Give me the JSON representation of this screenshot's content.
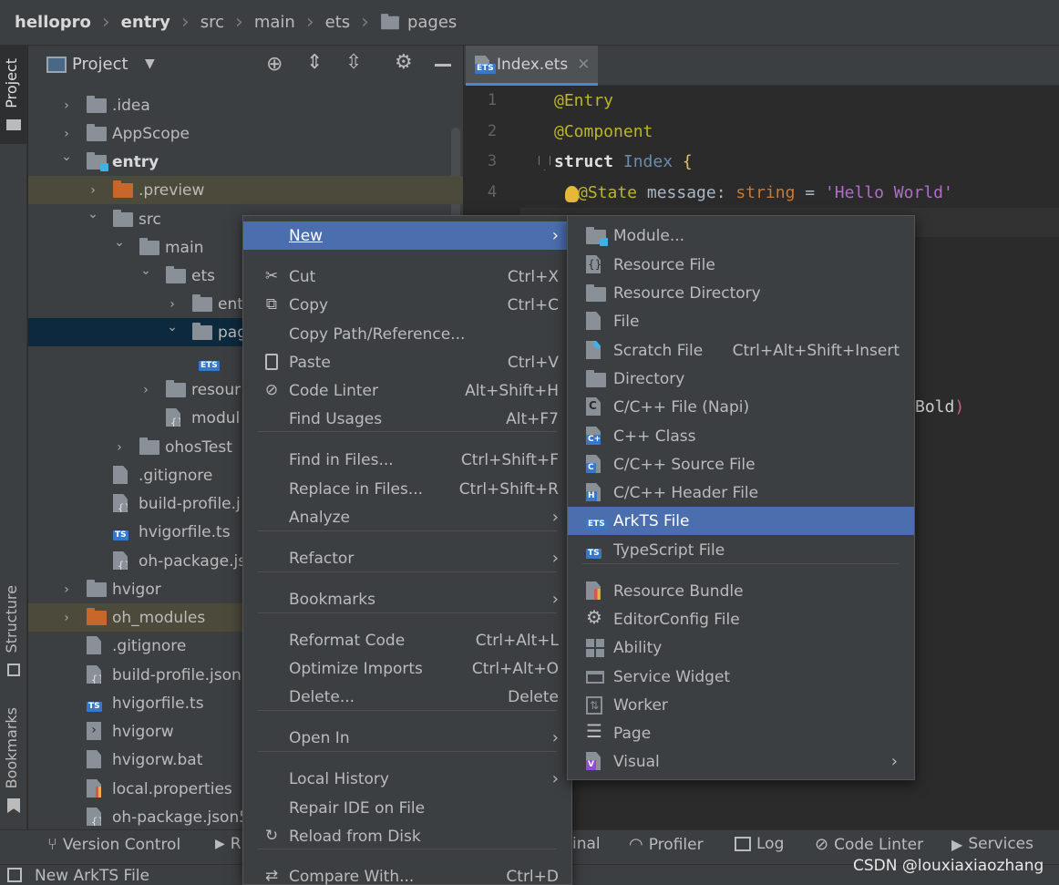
{
  "breadcrumb": [
    "hellopro",
    "entry",
    "src",
    "main",
    "ets",
    "pages"
  ],
  "left_strip": {
    "project": "Project",
    "structure": "Structure",
    "bookmarks": "Bookmarks"
  },
  "project_panel": {
    "title": "Project"
  },
  "tree": [
    {
      "label": ".idea",
      "indent": 0,
      "arrow": "›"
    },
    {
      "label": "AppScope",
      "indent": 0,
      "arrow": "›"
    },
    {
      "label": "entry",
      "indent": 0,
      "arrow": "⌄"
    },
    {
      "label": ".preview",
      "indent": 1,
      "arrow": "›"
    },
    {
      "label": "src",
      "indent": 1,
      "arrow": "⌄"
    },
    {
      "label": "main",
      "indent": 2,
      "arrow": "⌄"
    },
    {
      "label": "ets",
      "indent": 3,
      "arrow": "⌄"
    },
    {
      "label": "ent",
      "indent": 4,
      "arrow": "›"
    },
    {
      "label": "pag",
      "indent": 4,
      "arrow": "⌄"
    },
    {
      "label": "",
      "indent": 5,
      "arrow": ""
    },
    {
      "label": "resour",
      "indent": 3,
      "arrow": "›"
    },
    {
      "label": "modul",
      "indent": 3,
      "arrow": ""
    },
    {
      "label": "ohosTest",
      "indent": 2,
      "arrow": "›"
    },
    {
      "label": ".gitignore",
      "indent": 1,
      "arrow": ""
    },
    {
      "label": "build-profile.j",
      "indent": 1,
      "arrow": ""
    },
    {
      "label": "hvigorfile.ts",
      "indent": 1,
      "arrow": ""
    },
    {
      "label": "oh-package.js",
      "indent": 1,
      "arrow": ""
    },
    {
      "label": "hvigor",
      "indent": 0,
      "arrow": "›"
    },
    {
      "label": "oh_modules",
      "indent": 0,
      "arrow": "›"
    },
    {
      "label": ".gitignore",
      "indent": 0,
      "arrow": ""
    },
    {
      "label": "build-profile.json",
      "indent": 0,
      "arrow": ""
    },
    {
      "label": "hvigorfile.ts",
      "indent": 0,
      "arrow": ""
    },
    {
      "label": "hvigorw",
      "indent": 0,
      "arrow": ""
    },
    {
      "label": "hvigorw.bat",
      "indent": 0,
      "arrow": ""
    },
    {
      "label": "local.properties",
      "indent": 0,
      "arrow": ""
    },
    {
      "label": "oh-package.json5",
      "indent": 0,
      "arrow": ""
    }
  ],
  "editor": {
    "tab_label": "Index.ets",
    "lines": [
      "1",
      "2",
      "3",
      "4"
    ],
    "code": {
      "l1": "@Entry",
      "l2": "@Component",
      "l3_kw": "struct",
      "l3_name": "Index",
      "l3_brace": "{",
      "l4_dec": "@State",
      "l4_var": " message: ",
      "l4_type": "string",
      "l4_eq": " = ",
      "l4_str": "'Hello World'",
      "bold_text": "Bold",
      "bold_paren": ")"
    }
  },
  "context_menu": [
    {
      "label": "New",
      "shortcut": "",
      "submenu": true
    },
    {
      "label": "Cut",
      "shortcut": "Ctrl+X"
    },
    {
      "label": "Copy",
      "shortcut": "Ctrl+C"
    },
    {
      "label": "Copy Path/Reference...",
      "shortcut": ""
    },
    {
      "label": "Paste",
      "shortcut": "Ctrl+V"
    },
    {
      "label": "Code Linter",
      "shortcut": "Alt+Shift+H"
    },
    {
      "label": "Find Usages",
      "shortcut": "Alt+F7"
    },
    {
      "label": "Find in Files...",
      "shortcut": "Ctrl+Shift+F"
    },
    {
      "label": "Replace in Files...",
      "shortcut": "Ctrl+Shift+R"
    },
    {
      "label": "Analyze",
      "shortcut": "",
      "submenu": true
    },
    {
      "label": "Refactor",
      "shortcut": "",
      "submenu": true
    },
    {
      "label": "Bookmarks",
      "shortcut": "",
      "submenu": true
    },
    {
      "label": "Reformat Code",
      "shortcut": "Ctrl+Alt+L"
    },
    {
      "label": "Optimize Imports",
      "shortcut": "Ctrl+Alt+O"
    },
    {
      "label": "Delete...",
      "shortcut": "Delete"
    },
    {
      "label": "Open In",
      "shortcut": "",
      "submenu": true
    },
    {
      "label": "Local History",
      "shortcut": "",
      "submenu": true
    },
    {
      "label": "Repair IDE on File",
      "shortcut": ""
    },
    {
      "label": "Reload from Disk",
      "shortcut": ""
    },
    {
      "label": "Compare With...",
      "shortcut": "Ctrl+D"
    }
  ],
  "new_submenu": [
    {
      "label": "Module...",
      "shortcut": ""
    },
    {
      "label": "Resource File",
      "shortcut": ""
    },
    {
      "label": "Resource Directory",
      "shortcut": ""
    },
    {
      "label": "File",
      "shortcut": ""
    },
    {
      "label": "Scratch File",
      "shortcut": "Ctrl+Alt+Shift+Insert"
    },
    {
      "label": "Directory",
      "shortcut": ""
    },
    {
      "label": "C/C++ File (Napi)",
      "shortcut": ""
    },
    {
      "label": "C++ Class",
      "shortcut": ""
    },
    {
      "label": "C/C++ Source File",
      "shortcut": ""
    },
    {
      "label": "C/C++ Header File",
      "shortcut": ""
    },
    {
      "label": "ArkTS File",
      "shortcut": ""
    },
    {
      "label": "TypeScript File",
      "shortcut": ""
    },
    {
      "label": "Resource Bundle",
      "shortcut": ""
    },
    {
      "label": "EditorConfig File",
      "shortcut": ""
    },
    {
      "label": "Ability",
      "shortcut": ""
    },
    {
      "label": "Service Widget",
      "shortcut": ""
    },
    {
      "label": "Worker",
      "shortcut": ""
    },
    {
      "label": "Page",
      "shortcut": ""
    },
    {
      "label": "Visual",
      "shortcut": "",
      "submenu": true
    }
  ],
  "bottom_tabs": {
    "version_control": "Version Control",
    "run_partial": "R",
    "terminal_partial": "inal",
    "profiler": "Profiler",
    "log": "Log",
    "code_linter": "Code Linter",
    "services": "Services"
  },
  "status": {
    "text": "New ArkTS File"
  },
  "watermark": "CSDN @louxiaxiaozhang",
  "colors": {
    "selection": "#4b6eaf",
    "keyword": "#cc7832",
    "annotation": "#bbb529",
    "string": "#6a8759"
  }
}
